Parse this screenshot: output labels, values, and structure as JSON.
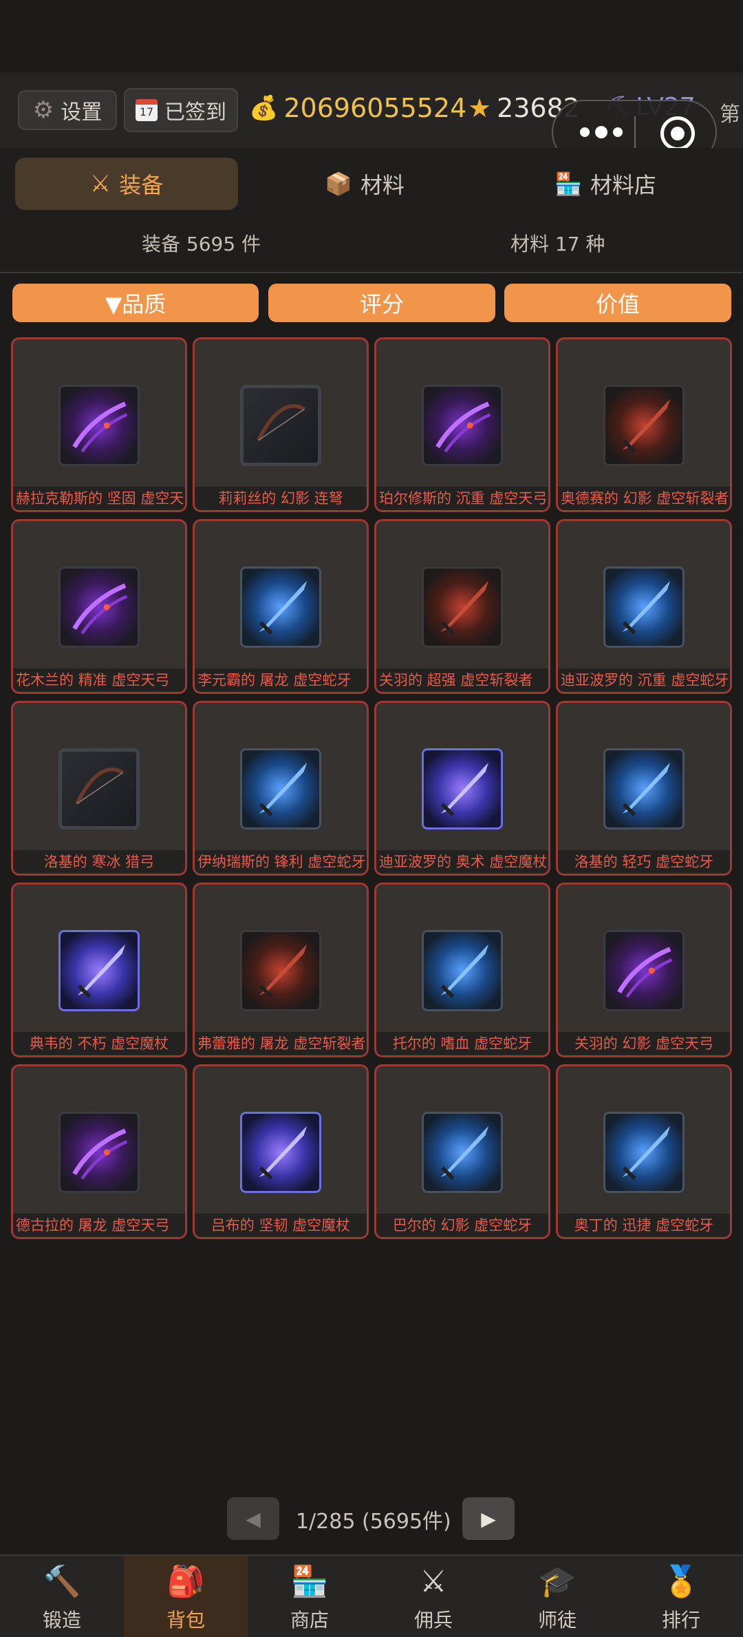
{
  "topbar": {
    "settings_label": "设置",
    "signin_label": "已签到",
    "gold": "20696055524",
    "stars": "23682",
    "level": "LV27",
    "rank_label": "第"
  },
  "tabs": [
    {
      "label": "装备",
      "icon": "crossed-swords-icon"
    },
    {
      "label": "材料",
      "icon": "package-icon"
    },
    {
      "label": "材料店",
      "icon": "store-icon"
    }
  ],
  "counts": {
    "equipment": "装备 5695 件",
    "materials": "材料 17 种"
  },
  "sort": {
    "quality": "▼品质",
    "score": "评分",
    "value": "价值"
  },
  "items": [
    {
      "name": "赫拉克勒斯的 坚固 虚空天弓",
      "icon": "void-bow-icon"
    },
    {
      "name": "莉莉丝的 幻影 连弩",
      "icon": "crossbow-icon"
    },
    {
      "name": "珀尔修斯的 沉重 虚空天弓",
      "icon": "void-bow-icon"
    },
    {
      "name": "奥德赛的 幻影 虚空斩裂者",
      "icon": "void-cleaver-icon"
    },
    {
      "name": "花木兰的 精准 虚空天弓",
      "icon": "void-bow-icon"
    },
    {
      "name": "李元霸的 屠龙 虚空蛇牙",
      "icon": "void-serpent-fang-icon"
    },
    {
      "name": "关羽的 超强 虚空斩裂者",
      "icon": "void-cleaver-icon"
    },
    {
      "name": "迪亚波罗的 沉重 虚空蛇牙",
      "icon": "void-serpent-fang-icon"
    },
    {
      "name": "洛基的 寒冰 猎弓",
      "icon": "hunting-bow-icon"
    },
    {
      "name": "伊纳瑞斯的 锋利 虚空蛇牙",
      "icon": "void-serpent-fang-icon"
    },
    {
      "name": "迪亚波罗的 奥术 虚空魔杖",
      "icon": "void-staff-icon"
    },
    {
      "name": "洛基的 轻巧 虚空蛇牙",
      "icon": "void-serpent-fang-icon"
    },
    {
      "name": "典韦的 不朽 虚空魔杖",
      "icon": "void-staff-icon"
    },
    {
      "name": "弗蕾雅的 屠龙 虚空斩裂者",
      "icon": "void-cleaver-icon"
    },
    {
      "name": "托尔的 嗜血 虚空蛇牙",
      "icon": "void-serpent-fang-icon"
    },
    {
      "name": "关羽的 幻影 虚空天弓",
      "icon": "void-bow-icon"
    },
    {
      "name": "德古拉的 屠龙 虚空天弓",
      "icon": "void-bow-icon"
    },
    {
      "name": "吕布的 坚韧 虚空魔杖",
      "icon": "void-staff-icon"
    },
    {
      "name": "巴尔的 幻影 虚空蛇牙",
      "icon": "void-serpent-fang-icon"
    },
    {
      "name": "奥丁的 迅捷 虚空蛇牙",
      "icon": "void-serpent-fang-icon"
    }
  ],
  "pager": {
    "text": "1/285  (5695件)",
    "prev": "◀",
    "next": "▶"
  },
  "bottom_nav": [
    {
      "label": "锻造",
      "icon": "hammer-icon"
    },
    {
      "label": "背包",
      "icon": "backpack-icon"
    },
    {
      "label": "商店",
      "icon": "store-icon"
    },
    {
      "label": "佣兵",
      "icon": "crossed-swords-icon"
    },
    {
      "label": "师徒",
      "icon": "graduation-cap-icon"
    },
    {
      "label": "排行",
      "icon": "medal-icon"
    }
  ],
  "colors": {
    "accent": "#f0954a",
    "active_text": "#f0a550",
    "item_name": "#e85a4a",
    "card_border": "#9c3a33",
    "gold": "#f0c24a"
  }
}
